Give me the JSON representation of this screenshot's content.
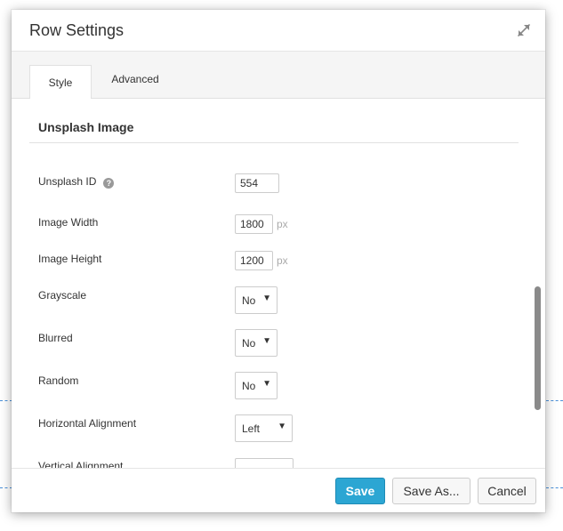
{
  "dialog": {
    "title": "Row Settings",
    "expand_icon": "expand-arrows-icon"
  },
  "tabs": [
    {
      "label": "Style",
      "active": true
    },
    {
      "label": "Advanced",
      "active": false
    }
  ],
  "section": {
    "title": "Unsplash Image"
  },
  "fields": {
    "unsplash_id": {
      "label": "Unsplash ID",
      "value": "554",
      "help_icon": "question-circle-icon"
    },
    "image_width": {
      "label": "Image Width",
      "value": "1800",
      "unit": "px"
    },
    "image_height": {
      "label": "Image Height",
      "value": "1200",
      "unit": "px"
    },
    "grayscale": {
      "label": "Grayscale",
      "value": "No"
    },
    "blurred": {
      "label": "Blurred",
      "value": "No"
    },
    "random": {
      "label": "Random",
      "value": "No"
    },
    "horizontal_alignment": {
      "label": "Horizontal Alignment",
      "value": "Left"
    },
    "vertical_alignment": {
      "label": "Vertical Alignment"
    }
  },
  "footer": {
    "save": "Save",
    "save_as": "Save As...",
    "cancel": "Cancel"
  },
  "colors": {
    "primary_button": "#2ca6d3",
    "guide_dash": "#4a90d9"
  }
}
